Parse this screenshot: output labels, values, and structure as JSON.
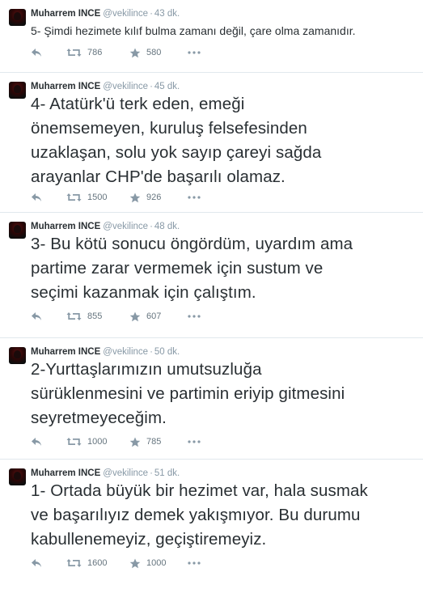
{
  "tweets": [
    {
      "name": "Muharrem INCE",
      "handle": "@vekilince",
      "time": "43 dk.",
      "size": "small",
      "lines": [
        "5- Şimdi hezimete kılıf bulma zamanı değil, çare olma zamanıdır."
      ],
      "retweets": "786",
      "favorites": "580"
    },
    {
      "name": "Muharrem INCE",
      "handle": "@vekilince",
      "time": "45 dk.",
      "size": "large",
      "lines": [
        "4- Atatürk'ü terk eden, emeği",
        "önemsemeyen, kuruluş felsefesinden",
        "uzaklaşan, solu yok sayıp çareyi sağda",
        "arayanlar CHP'de başarılı olamaz."
      ],
      "retweets": "1500",
      "favorites": "926"
    },
    {
      "name": "Muharrem INCE",
      "handle": "@vekilince",
      "time": "48 dk.",
      "size": "large",
      "lines": [
        "3- Bu kötü sonucu öngördüm, uyardım ama",
        "partime zarar vermemek için sustum ve",
        "seçimi kazanmak için çalıştım."
      ],
      "retweets": "855",
      "favorites": "607"
    },
    {
      "name": "Muharrem INCE",
      "handle": "@vekilince",
      "time": "50 dk.",
      "size": "large",
      "lines": [
        "2-Yurttaşlarımızın umutsuzluğa",
        "sürüklenmesini ve partimin eriyip gitmesini",
        "seyretmeyeceğim."
      ],
      "retweets": "1000",
      "favorites": "785"
    },
    {
      "name": "Muharrem INCE",
      "handle": "@vekilince",
      "time": "51 dk.",
      "size": "large",
      "lines": [
        "1- Ortada büyük bir hezimet var, hala susmak",
        "ve başarılıyız demek yakışmıyor. Bu durumu",
        "kabullenemeyiz, geçiştiremeyiz."
      ],
      "retweets": "1600",
      "favorites": "1000"
    }
  ],
  "colors": {
    "text": "#292f33",
    "muted": "#8899a6",
    "count": "#66757f",
    "divider": "#e1e8ed"
  },
  "icons": [
    "reply-icon",
    "retweet-icon",
    "favorite-star-icon",
    "more-dots-icon"
  ]
}
